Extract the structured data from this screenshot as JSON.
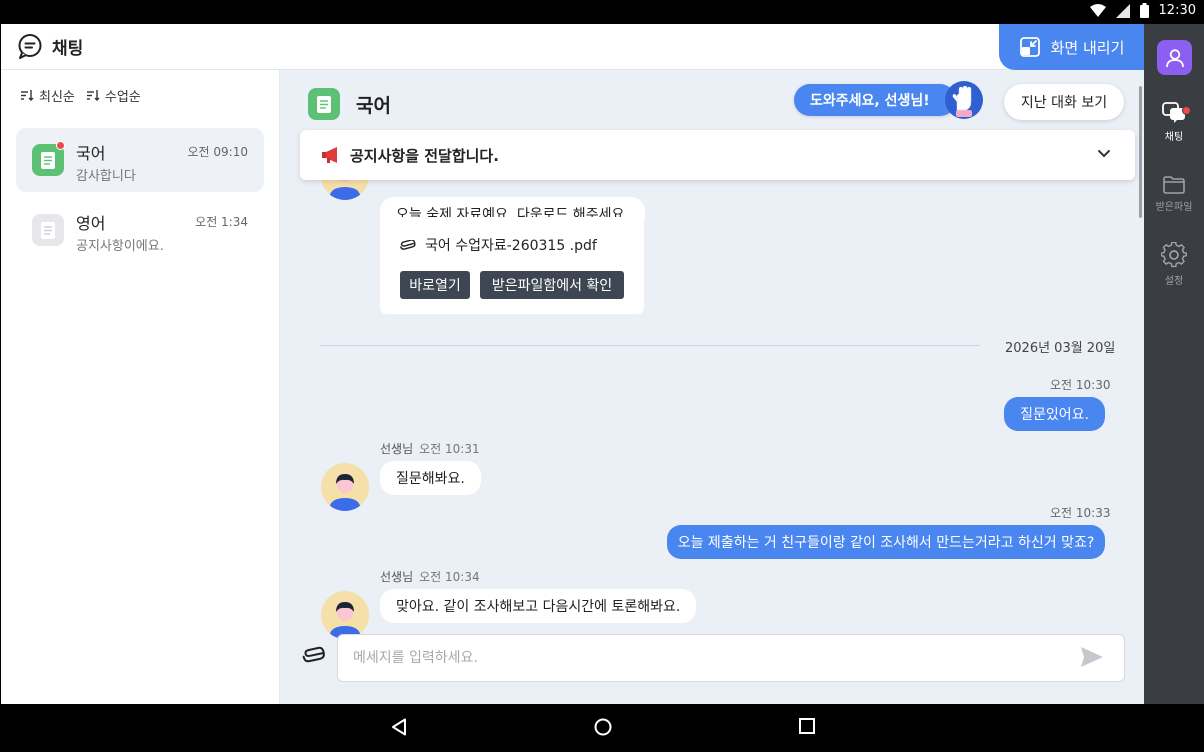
{
  "status_bar": {
    "time": "12:30"
  },
  "header": {
    "title": "채팅",
    "minimize_label": "화면 내리기"
  },
  "sort": {
    "latest": "최신순",
    "by_class": "수업순"
  },
  "rooms": [
    {
      "name": "국어",
      "time": "오전 09:10",
      "last_message": "감사합니다",
      "unread": true
    },
    {
      "name": "영어",
      "time": "오전 1:34",
      "last_message": "공지사항이에요.",
      "unread": false
    }
  ],
  "chat": {
    "room_name": "국어",
    "help_label": "도와주세요, 선생님!",
    "history_label": "지난 대화 보기",
    "notice": "공지사항을 전달합니다.",
    "messages": {
      "m0_text": "오늘 숙제 자료예요. 다운로드 해주세요.",
      "file_name": "국어 수업자료-260315 .pdf",
      "file_open": "바로열기",
      "file_inbox": "받은파일함에서 확인",
      "date": "2026년 03월 20일",
      "m1_time": "오전 10:30",
      "m1_text": "질문있어요.",
      "m2_sender": "선생님",
      "m2_time": "오전 10:31",
      "m2_text": "질문해봐요.",
      "m3_time": "오전 10:33",
      "m3_text": "오늘 제출하는 거 친구들이랑 같이 조사해서 만드는거라고 하신거 맞죠?",
      "m4_sender": "선생님",
      "m4_time": "오전 10:34",
      "m4_text": "맞아요. 같이 조사해보고 다음시간에 토론해봐요."
    },
    "input_placeholder": "메세지를 입력하세요."
  },
  "rail": {
    "chat": "채팅",
    "files": "받은파일",
    "settings": "설정"
  },
  "colors": {
    "accent": "#4a86f0",
    "green": "#5cc174",
    "rail": "#3a3d42",
    "purple": "#8d5ff0",
    "badge": "#e94a4a"
  }
}
